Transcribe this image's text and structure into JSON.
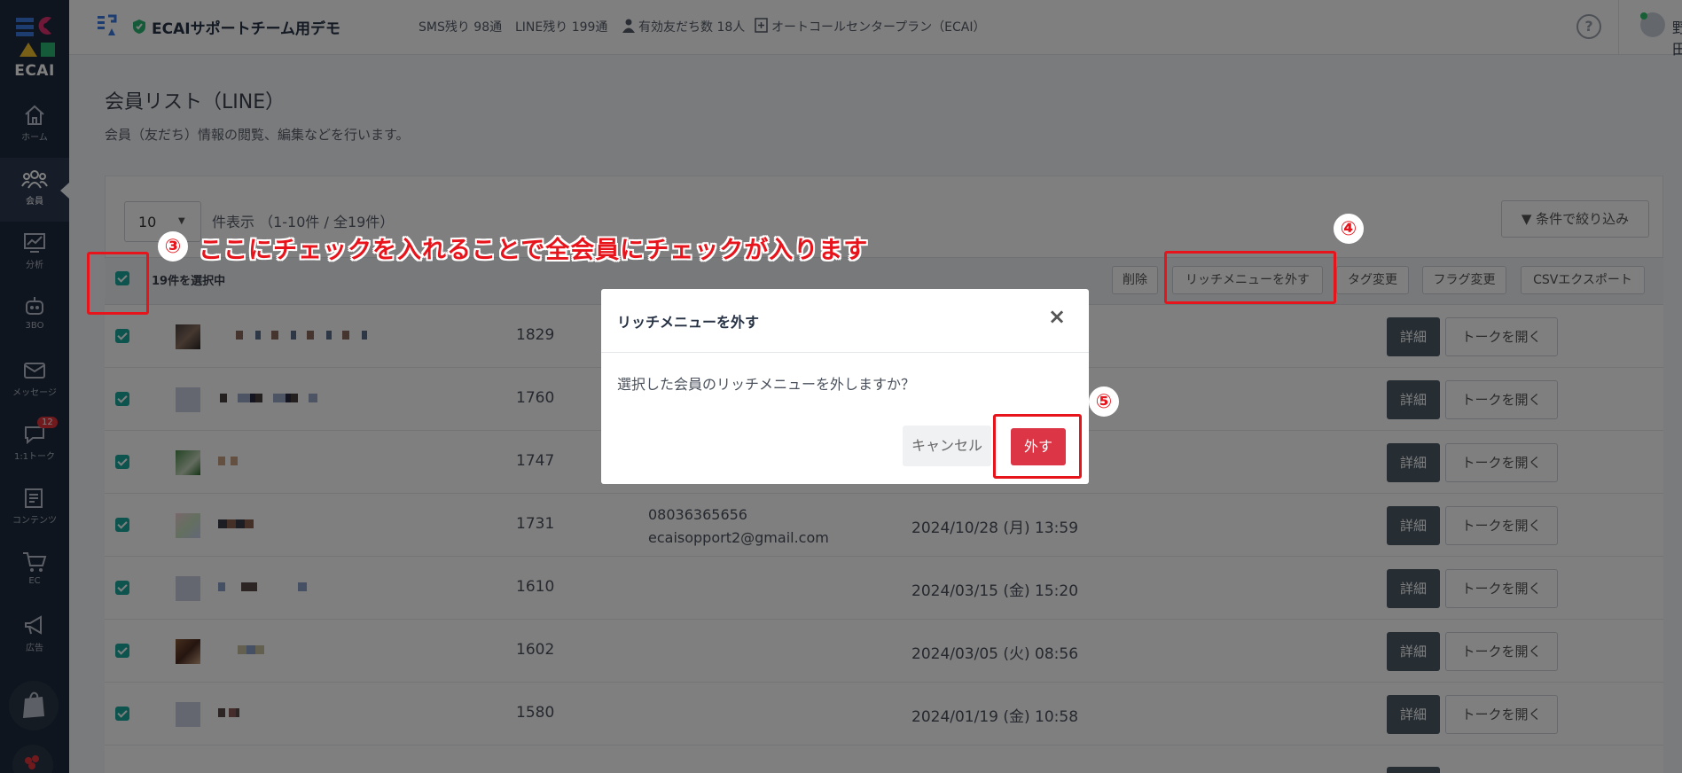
{
  "app": {
    "logo_text": "ECAI"
  },
  "sidebar": {
    "items": [
      {
        "label": "ホーム",
        "icon": "home-icon"
      },
      {
        "label": "会員",
        "icon": "members-icon"
      },
      {
        "label": "分析",
        "icon": "analytics-icon"
      },
      {
        "label": "3BO",
        "icon": "bot-icon"
      },
      {
        "label": "メッセージ",
        "icon": "message-icon"
      },
      {
        "label": "1:1トーク",
        "icon": "chat-icon",
        "badge": "12"
      },
      {
        "label": "コンテンツ",
        "icon": "content-icon"
      },
      {
        "label": "EC",
        "icon": "cart-icon"
      },
      {
        "label": "広告",
        "icon": "megaphone-icon"
      }
    ]
  },
  "header": {
    "shop_name": "ECAIサポートチーム用デモ",
    "sms": "SMS残り 98通",
    "line": "LINE残り 199通",
    "friends": "有効友だち数 18人",
    "plan": "オートコールセンタープラン（ECAI）",
    "username": "野田"
  },
  "page": {
    "title": "会員リスト（LINE）",
    "description": "会員（友だち）情報の閲覧、編集などを行います。"
  },
  "toolbar": {
    "page_size": "10",
    "show_info": "件表示 （1-10件 / 全19件）",
    "filter_label": "条件で絞り込み",
    "selected_text": "19件を選択中",
    "delete_label": "削除",
    "remove_richmenu_label": "リッチメニューを外す",
    "tag_change_label": "タグ変更",
    "flag_change_label": "フラグ変更",
    "csv_export_label": "CSVエクスポート"
  },
  "rows": [
    {
      "id": "1829",
      "phone": "",
      "email": "",
      "date": ""
    },
    {
      "id": "1760",
      "phone": "",
      "email": "",
      "date": ""
    },
    {
      "id": "1747",
      "phone": "",
      "email": "",
      "date": ""
    },
    {
      "id": "1731",
      "phone": "08036365656",
      "email": "ecaisopport2@gmail.com",
      "date": "2024/10/28 (月) 13:59"
    },
    {
      "id": "1610",
      "phone": "",
      "email": "",
      "date": "2024/03/15 (金) 15:20"
    },
    {
      "id": "1602",
      "phone": "",
      "email": "",
      "date": "2024/03/05 (火) 08:56"
    },
    {
      "id": "1580",
      "phone": "",
      "email": "",
      "date": "2024/01/19 (金) 10:58"
    }
  ],
  "row_buttons": {
    "detail": "詳細",
    "talk": "トークを開く"
  },
  "modal": {
    "title": "リッチメニューを外す",
    "close": "×",
    "body": "選択した会員のリッチメニューを外しますか？",
    "cancel": "キャンセル",
    "confirm": "外す"
  },
  "annotations": {
    "step3": "③",
    "step3_text": "ここにチェックを入れることで全会員にチェックが入ります",
    "step4": "④",
    "step5": "⑤"
  },
  "colors": {
    "sidebar": "#1f2a3c",
    "accent_teal": "#1aa79d",
    "danger": "#dc3545",
    "annotation_red": "#e8141c"
  }
}
